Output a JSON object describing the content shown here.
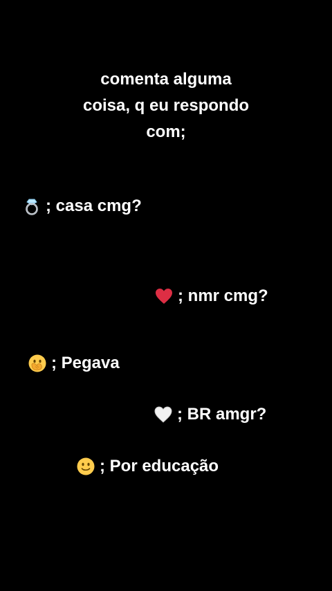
{
  "title_lines": [
    "comenta alguma",
    "coisa, q eu respondo",
    "com;"
  ],
  "items": [
    {
      "icon": "ring-icon",
      "text": "; casa cmg?"
    },
    {
      "icon": "red-heart-icon",
      "text": "; nmr cmg?"
    },
    {
      "icon": "face-with-hand-over-mouth-icon",
      "text": "; Pegava"
    },
    {
      "icon": "white-heart-icon",
      "text": "; BR amgr?"
    },
    {
      "icon": "slightly-smiling-face-icon",
      "text": "; Por educação"
    }
  ],
  "colors": {
    "background": "#000000",
    "text": "#ffffff",
    "heart_red": "#dd2e44",
    "emoji_yellow": "#ffcc4d"
  }
}
